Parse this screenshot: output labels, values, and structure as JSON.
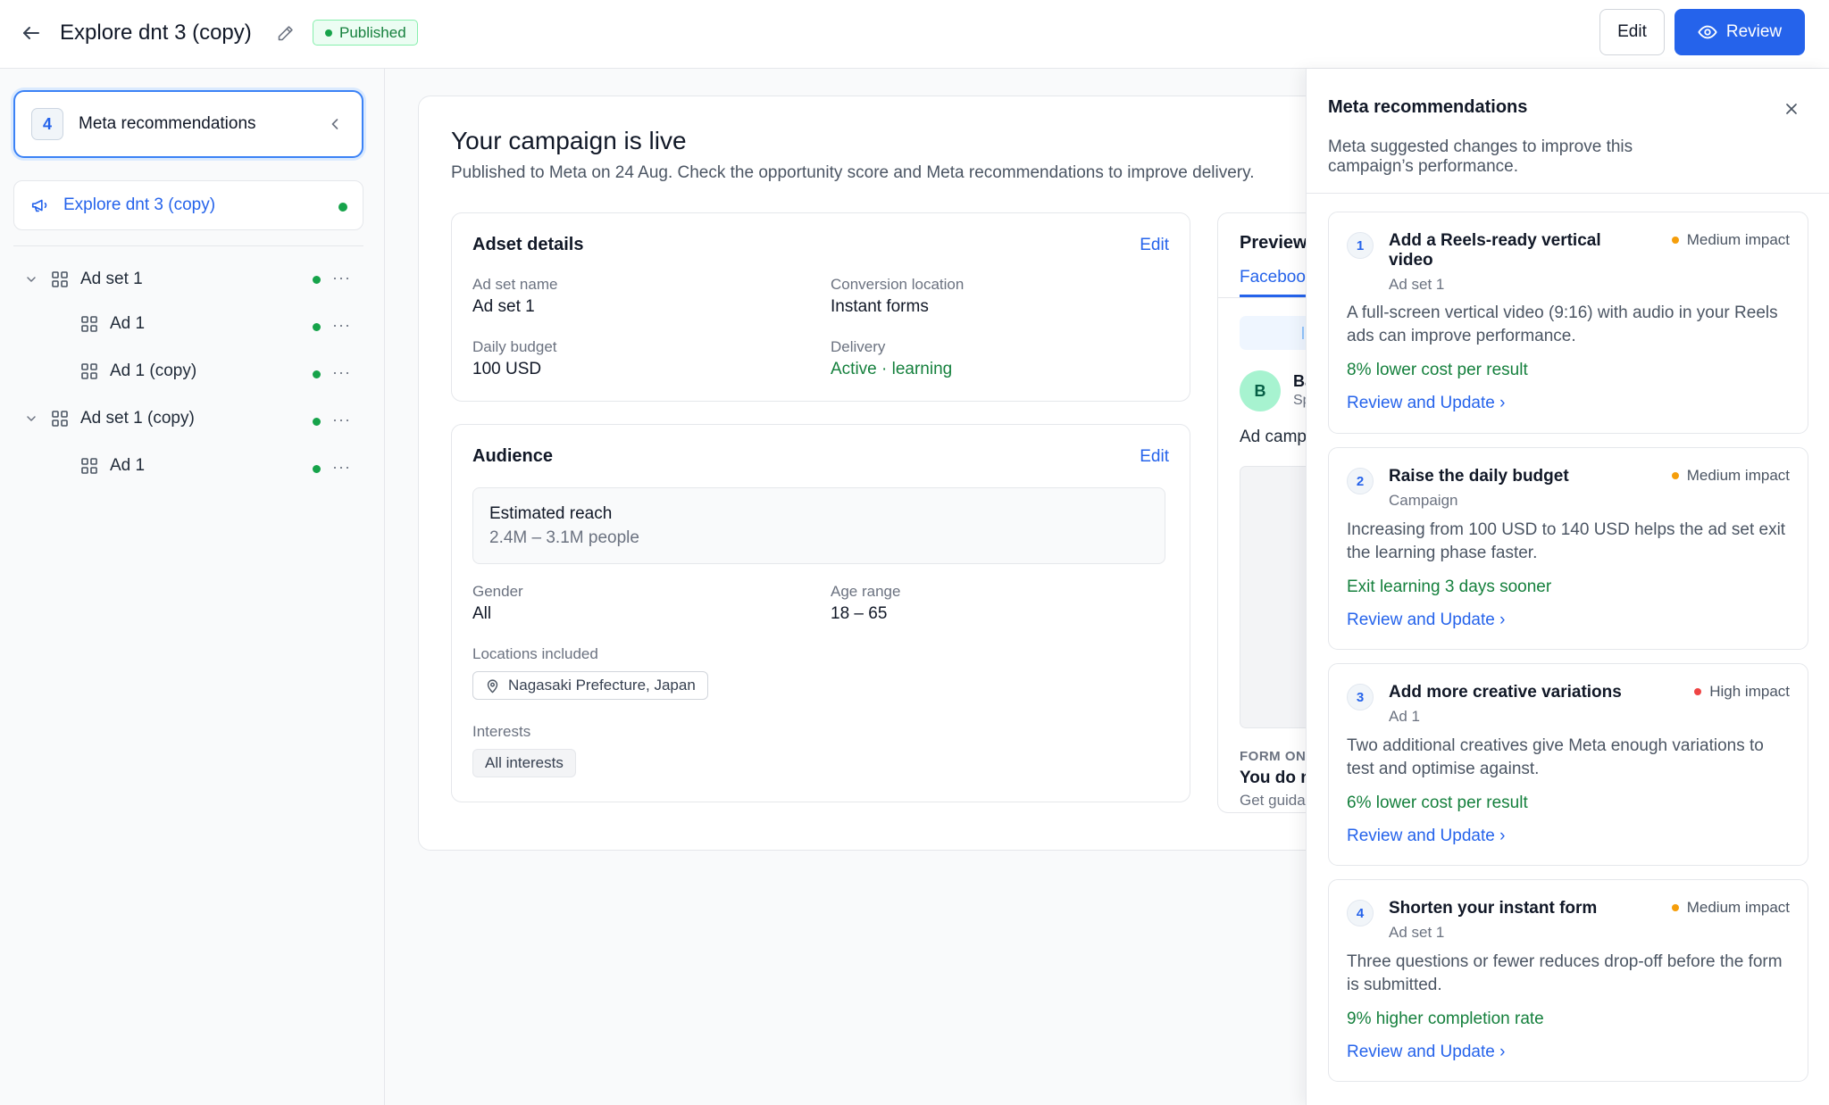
{
  "header": {
    "title": "Explore dnt 3 (copy)",
    "status": "Published",
    "edit_label": "Edit",
    "review_label": "Review"
  },
  "sidebar": {
    "recommendations_count": "4",
    "recommendations_label": "Meta recommendations",
    "campaign_name": "Explore dnt 3 (copy)",
    "tree": [
      {
        "label": "Ad set 1",
        "type": "adset"
      },
      {
        "label": "Ad 1",
        "type": "ad"
      },
      {
        "label": "Ad 1 (copy)",
        "type": "ad"
      },
      {
        "label": "Ad set 1 (copy)",
        "type": "adset"
      },
      {
        "label": "Ad 1",
        "type": "ad"
      }
    ],
    "more_glyph": "···"
  },
  "main": {
    "title": "Your campaign is live",
    "subtitle": "Published to Meta on 24 Aug. Check the opportunity score and Meta recommendations to improve delivery.",
    "adset_card": {
      "title": "Adset details",
      "edit_label": "Edit",
      "ad_set_name_label": "Ad set name",
      "ad_set_name": "Ad set 1",
      "conversion_location_label": "Conversion location",
      "conversion_location": "Instant forms",
      "daily_budget_label": "Daily budget",
      "daily_budget": "100 USD",
      "delivery_label": "Delivery",
      "delivery": "Active · learning"
    },
    "audience_card": {
      "title": "Audience",
      "edit_label": "Edit",
      "reach_title": "Estimated reach",
      "reach_value": "2.4M – 3.1M people",
      "gender_label": "Gender",
      "gender": "All",
      "age_label": "Age range",
      "age": "18 – 65",
      "locations_label": "Locations included",
      "location": "Nagasaki Prefecture, Japan",
      "interests_label": "Interests",
      "interests": "All interests"
    },
    "preview_card": {
      "title": "Preview",
      "tab": "Facebook",
      "avatar_letter": "B",
      "page_name": "Ba",
      "sponsored": "Sp",
      "text": "Ad camp",
      "form_on": "FORM ON",
      "form_title": "You do n",
      "form_sub": "Get guida"
    }
  },
  "panel": {
    "title": "Meta recommendations",
    "description": "Meta suggested changes to improve this campaign’s performance.",
    "recommendations": [
      {
        "number": "1",
        "title": "Add a Reels-ready vertical video",
        "scope": "Ad set 1",
        "impact": "Medium impact",
        "impact_color": "#f59e0b",
        "description": "A full-screen vertical video (9:16) with audio in your Reels ads can improve performance.",
        "benefit": "8% lower cost per result",
        "link": "Review and Update ›"
      },
      {
        "number": "2",
        "title": "Raise the daily budget",
        "scope": "Campaign",
        "impact": "Medium impact",
        "impact_color": "#f59e0b",
        "description": "Increasing from 100 USD to 140 USD helps the ad set exit the learning phase faster.",
        "benefit": "Exit learning 3 days sooner",
        "link": "Review and Update ›"
      },
      {
        "number": "3",
        "title": "Add more creative variations",
        "scope": "Ad 1",
        "impact": "High impact",
        "impact_color": "#ef4444",
        "description": "Two additional creatives give Meta enough variations to test and optimise against.",
        "benefit": "6% lower cost per result",
        "link": "Review and Update ›"
      },
      {
        "number": "4",
        "title": "Shorten your instant form",
        "scope": "Ad set 1",
        "impact": "Medium impact",
        "impact_color": "#f59e0b",
        "description": "Three questions or fewer reduces drop-off before the form is submitted.",
        "benefit": "9% higher completion rate",
        "link": "Review and Update ›"
      }
    ]
  }
}
